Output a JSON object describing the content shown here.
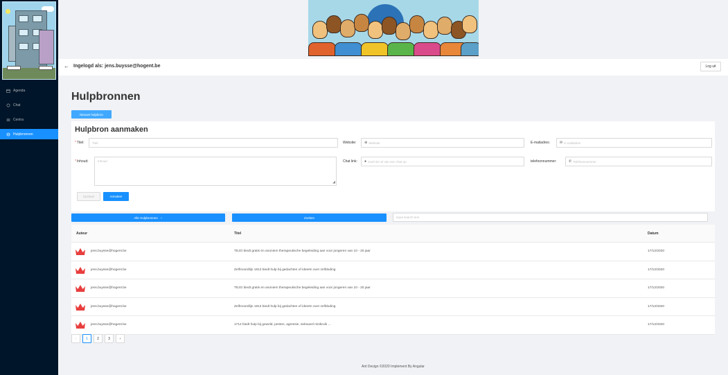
{
  "sidebar": {
    "items": [
      {
        "label": "Agenda",
        "icon": "calendar-icon",
        "active": false
      },
      {
        "label": "Chat",
        "icon": "chat-icon",
        "active": false
      },
      {
        "label": "Centra",
        "icon": "bank-icon",
        "active": false
      },
      {
        "label": "Hulpbronnen",
        "icon": "globe-icon",
        "active": true
      }
    ]
  },
  "header": {
    "logged_in": "Ingelogd als: jens.buysse@hogent.be",
    "logout_label": "Log uit"
  },
  "page": {
    "title": "Hulpbronnen",
    "new_button": "Nieuwe hulpbron"
  },
  "form": {
    "title": "Hulpbron aanmaken",
    "titel_label": "Titel:",
    "titel_placeholder": "Titel",
    "website_label": "Website:",
    "website_placeholder": "Website",
    "email_label": "E-mailadres:",
    "email_placeholder": "E-mailadres",
    "inhoud_label": "Inhoud:",
    "inhoud_placeholder": "Inhoud",
    "chat_label": "Chat link:",
    "chat_placeholder": "Geef de url van een chat op",
    "tel_label": "telefoonnummer:",
    "tel_placeholder": "Telefoonnummer",
    "submit_label": "Opslaan",
    "cancel_label": "Annuleer"
  },
  "filters": {
    "dropdown_label": "Alle Hulpbronnen",
    "search_button": "Zoeken",
    "search_placeholder": "input search text"
  },
  "table": {
    "headers": [
      "Auteur",
      "Titel",
      "Datum"
    ],
    "rows": [
      {
        "author": "jens.buysse@hogent.be",
        "title": "TEJO biedt gratis en anoniem therapeutische begeleiding aan voor jongeren van 10 - 20 jaar",
        "date": "17/12/2020"
      },
      {
        "author": "jens.buysse@hogent.be",
        "title": "Zelfmoordlijn 1813 biedt hulp bij gedachten of ideeën over zelfdoding",
        "date": "17/12/2020"
      },
      {
        "author": "jens.buysse@hogent.be",
        "title": "TEJO biedt gratis en anoniem therapeutische begeleiding aan voor jongeren van 10 - 20 jaar",
        "date": "17/12/2020"
      },
      {
        "author": "jens.buysse@hogent.be",
        "title": "Zelfmoordlijn 1813 biedt hulp bij gedachten of ideeën over zelfdoding",
        "date": "17/12/2020"
      },
      {
        "author": "jens.buysse@hogent.be",
        "title": "1712 biedt hulp bij geweld, pesten, agressie, seksueel misbruik ...",
        "date": "17/12/2020"
      }
    ]
  },
  "pagination": {
    "prev": "‹",
    "pages": [
      "1",
      "2",
      "3"
    ],
    "next": "›"
  },
  "footer": "Ant Design ©2020 Implement By Angular"
}
